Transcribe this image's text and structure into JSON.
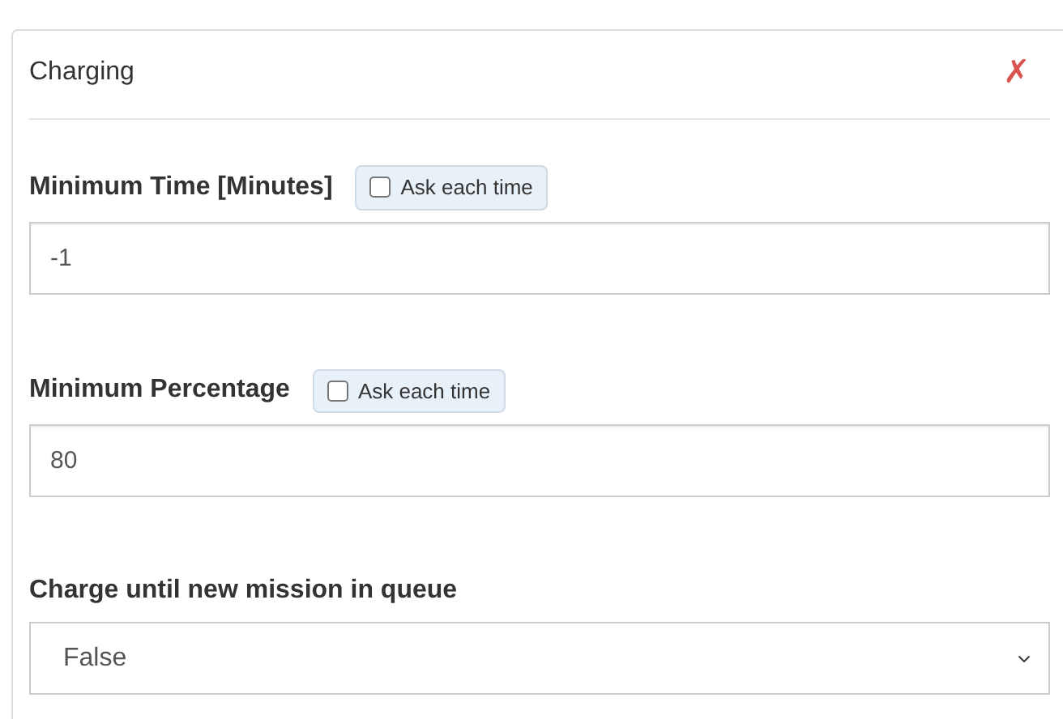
{
  "panel": {
    "title": "Charging",
    "close": "✗"
  },
  "fields": [
    {
      "kind": "input",
      "label": "Minimum Time [Minutes]",
      "ask": {
        "label": "Ask each time",
        "checked": false
      },
      "value": "-1"
    },
    {
      "kind": "input",
      "label": "Minimum Percentage",
      "ask": {
        "label": "Ask each time",
        "checked": false
      },
      "value": "80"
    },
    {
      "kind": "select",
      "label": "Charge until new mission in queue",
      "value": "False"
    }
  ]
}
